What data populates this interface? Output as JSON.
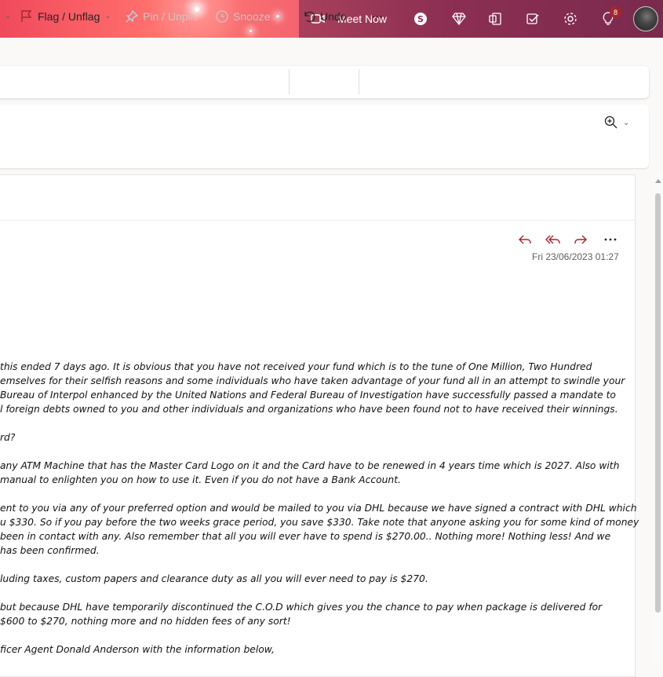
{
  "header": {
    "meet_now_label": "Meet Now",
    "notification_count": "8",
    "icons": [
      "video-icon",
      "skype-icon",
      "diamond-icon",
      "office-icon",
      "todo-icon",
      "gear-icon",
      "lightbulb-icon",
      "avatar"
    ]
  },
  "toolbar": {
    "flag_label": "Flag / Unflag",
    "pin_label": "Pin / Unpin",
    "snooze_label": "Snooze",
    "undo_label": "Undo",
    "more_label": "···"
  },
  "message": {
    "date": "Fri 23/06/2023 01:27",
    "body_lines": [
      "this ended 7 days ago. It is obvious that you have not received your fund which is to the tune of One Million, Two Hundred",
      "emselves for their selfish reasons and some individuals who have taken advantage of your fund all in an attempt to swindle your",
      " Bureau of Interpol enhanced by the United Nations and Federal Bureau of Investigation have successfully passed a mandate to",
      "l foreign debts owned to you and other individuals and organizations who have been found not to have received their winnings.",
      "",
      "rd?",
      "",
      "any ATM Machine that has the Master Card Logo on it and the Card have to be renewed in 4 years time which is 2027. Also with",
      "manual to enlighten you on how to use it. Even if you do not have a Bank Account.",
      "",
      "ent to you via any of your preferred option and would be mailed to you via DHL because we have signed a contract with DHL which",
      "u $330. So if you pay before the two weeks grace period, you save $330. Take note that anyone asking you for some kind of money",
      " been in contact with any. Also remember that all you will ever have to spend is $270.00.. Nothing more! Nothing less! And we",
      "has been confirmed.",
      "",
      "luding taxes, custom papers and clearance duty as all you will ever need to pay is $270.",
      "",
      " but because DHL have temporarily discontinued the C.O.D which gives you the chance to pay when package is delivered for",
      "$600 to $270, nothing more and no hidden fees of any sort!",
      "",
      "ficer Agent Donald Anderson with the information below,"
    ]
  }
}
